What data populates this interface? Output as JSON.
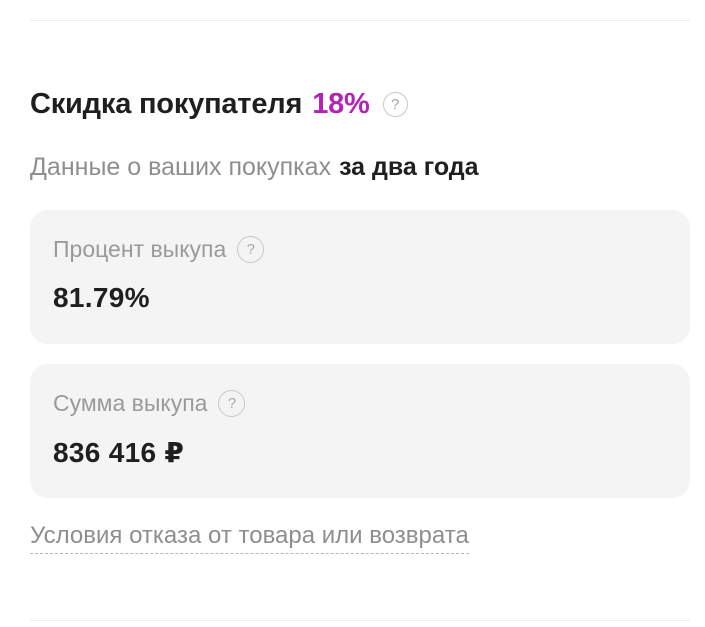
{
  "discount": {
    "title": "Скидка покупателя",
    "percent": "18%",
    "help_glyph": "?",
    "accent_color": "#b423b6"
  },
  "subtitle": {
    "text": "Данные о ваших покупках",
    "period": "за два года"
  },
  "cards": [
    {
      "label": "Процент выкупа",
      "help_glyph": "?",
      "value": "81.79%"
    },
    {
      "label": "Сумма выкупа",
      "help_glyph": "?",
      "value": "836 416 ₽"
    }
  ],
  "terms_link": "Условия отказа от товара или возврата",
  "icons": {
    "help": "question-circle-icon"
  }
}
